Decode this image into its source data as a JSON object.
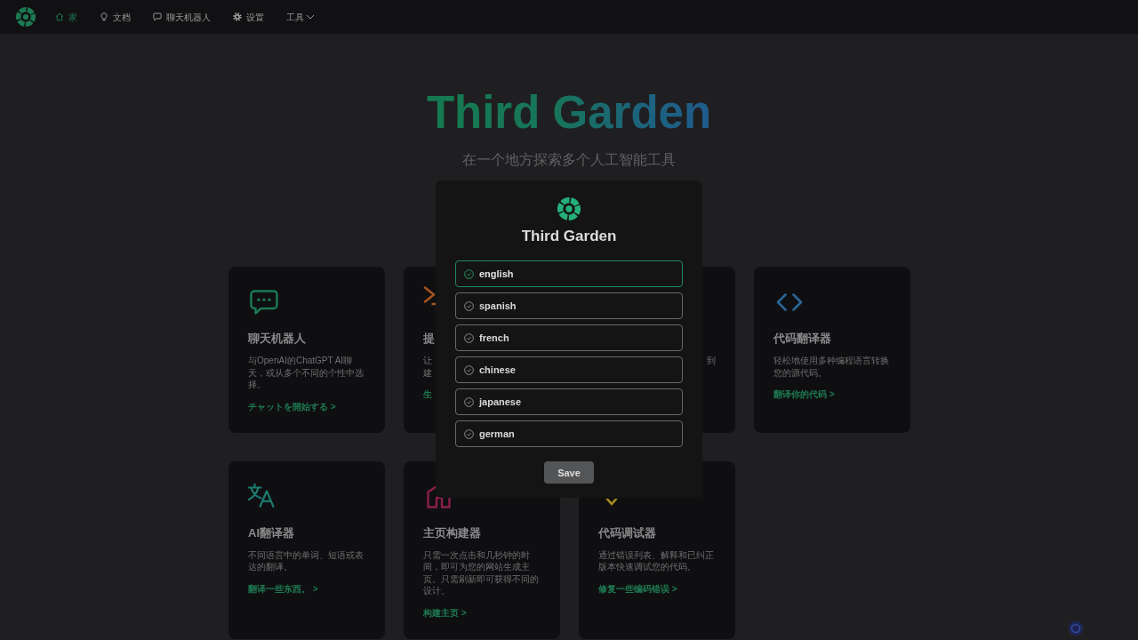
{
  "nav": {
    "items": [
      {
        "kind": "link",
        "label": "家",
        "selected": true
      },
      {
        "kind": "link",
        "label": "文档",
        "selected": false
      },
      {
        "kind": "link",
        "label": "聊天机器人",
        "selected": false
      },
      {
        "kind": "link",
        "label": "设置",
        "selected": false
      },
      {
        "kind": "menu",
        "label": "工具",
        "selected": false
      }
    ]
  },
  "hero": {
    "title": "Third Garden",
    "subtitle": "在一个地方探索多个人工智能工具"
  },
  "cards": [
    {
      "kind": "full",
      "color": "#1b7a52",
      "title": "聊天机器人",
      "description": "与OpenAI的ChatGPT AI聊天，或从多个不同的个性中选择。",
      "link": "チャットを開始する >"
    },
    {
      "kind": "clipped_right",
      "color": "#a8561e",
      "title": "提",
      "description_lines": [
        "让",
        "建"
      ],
      "link": "生"
    },
    {
      "kind": "clipped_left",
      "description_lines": [
        "到"
      ]
    },
    {
      "kind": "full",
      "color": "#2a6596",
      "title": "代码翻译器",
      "description": "轻松地使用多种编程语言转换您的源代码。",
      "link": "翻译你的代码 >"
    },
    {
      "kind": "full",
      "color": "#1c7a6e",
      "title": "AI翻译器",
      "description": "不同语言中的单词、短语或表达的翻译。",
      "link": "翻译一些东西。 >"
    },
    {
      "kind": "full",
      "color": "#8f1f4a",
      "title": "主页构建器",
      "description": "只需一次点击和几秒钟的时间，即可为您的网站生成主页。只需刷新即可获得不同的设计。",
      "link": "构建主页 >"
    },
    {
      "kind": "full",
      "color": "#a58a1e",
      "title": "代码调试器",
      "description": "通过错误列表、解释和已纠正版本快速调试您的代码。",
      "link": "修复一些编码错误 >"
    }
  ],
  "modal": {
    "title": "Third Garden",
    "options": [
      {
        "label": "english",
        "selected": true
      },
      {
        "label": "spanish",
        "selected": false
      },
      {
        "label": "french",
        "selected": false
      },
      {
        "label": "chinese",
        "selected": false
      },
      {
        "label": "japanese",
        "selected": false
      },
      {
        "label": "german",
        "selected": false
      }
    ],
    "button": "Save"
  }
}
